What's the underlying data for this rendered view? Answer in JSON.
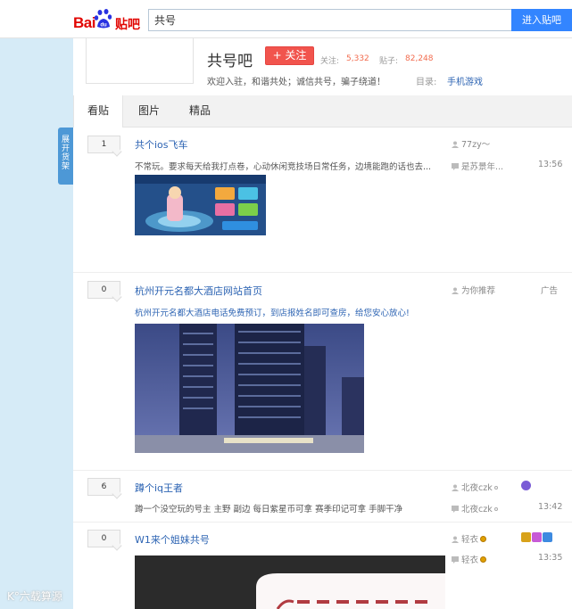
{
  "header": {
    "logo_bai": "Bai",
    "logo_du": "du",
    "logo_tieba": "贴吧",
    "search_value": "共号",
    "search_button": "进入贴吧"
  },
  "forum": {
    "name": "共号吧",
    "follow_label": "+ 关注",
    "followers_label": "关注:",
    "followers_value": "5,332",
    "posts_label": "贴子:",
    "posts_value": "82,248",
    "slogan": "欢迎入驻，和谐共处；诚信共号，骗子绕道！",
    "category_label": "目录:",
    "category_link": "手机游戏"
  },
  "tabs": [
    "看贴",
    "图片",
    "精品"
  ],
  "side_tab": [
    "展",
    "开",
    "货",
    "架"
  ],
  "threads": [
    {
      "replies": "1",
      "title": "共个ios飞车",
      "abstract": "不常玩。要求每天给我打点卷，心动休闲竞技场日常任务，边境能跑的话也去...",
      "author": "77zy～",
      "last_reply": "是苏景年...",
      "time": "13:56"
    },
    {
      "replies": "0",
      "title": "杭州开元名都大酒店网站首页",
      "abstract": "杭州开元名都大酒店电话免费预订，到店报姓名即可查房，给您安心放心!",
      "author": "为你推荐",
      "ad_label": "广告"
    },
    {
      "replies": "6",
      "title": "蹲个iq王者",
      "abstract": "蹲一个没空玩的号主 主野 副边 每日紫星币可拿 赛季印记可拿 手脚干净",
      "author": "北夜czk",
      "last_reply": "北夜czk",
      "time": "13:42"
    },
    {
      "replies": "0",
      "title": "W1来个姐妹共号",
      "author": "轻衣",
      "last_reply": "轻衣",
      "time": "13:35"
    }
  ],
  "watermark": "K°六载算源",
  "colors": {
    "accent_blue": "#3385ff",
    "link_blue": "#2d64b3",
    "follow_red": "#f1544d",
    "stat_orange": "#f26c4f",
    "page_bg": "#d6ebf7"
  }
}
